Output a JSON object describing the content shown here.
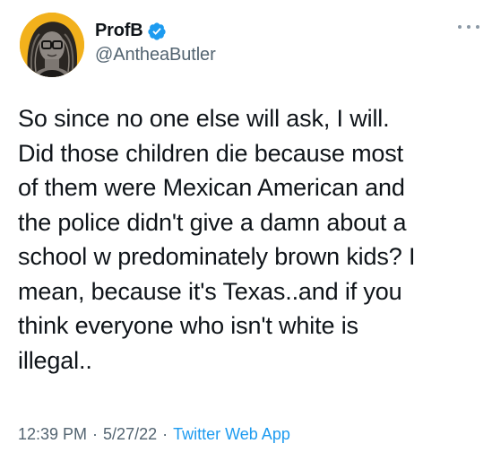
{
  "author": {
    "display_name": "ProfB",
    "handle": "@AntheaButler",
    "verified": true,
    "verified_icon": "verified-badge-icon",
    "avatar_icon": "profile-avatar"
  },
  "tweet": {
    "text": "So since no one else will ask, I will.\nDid those children die because most\nof them were Mexican American and\nthe police didn't give a damn about a\nschool w predominately brown kids? I\nmean, because it's Texas..and if you\nthink everyone who isn't white is\nillegal..",
    "time": "12:39 PM",
    "date": "5/27/22",
    "separator": "·",
    "source": "Twitter Web App"
  },
  "colors": {
    "text_primary": "#0f1419",
    "text_secondary": "#536471",
    "link": "#1d9bf0",
    "verified": "#1d9bf0",
    "avatar_bg": "#f2b11c"
  }
}
